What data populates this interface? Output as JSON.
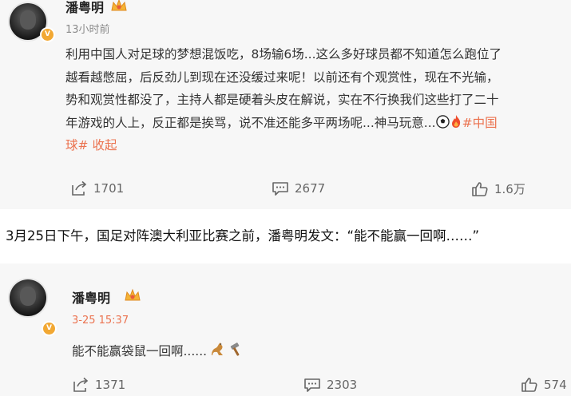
{
  "post1": {
    "username": "潘粤明",
    "time": "13小时前",
    "lines": [
      "利用中国人对足球的梦想混饭吃，8场输6场...这么多好球员都不知道怎么跑位了",
      "越看越憋屈，后反劲儿到现在还没缓过来呢！以前还有个观赏性，现在不光输，",
      "势和观赏性都没了，主持人都是硬着头皮在解说，实在不行换我们这些打了二十",
      "年游戏的人上，反正都是挨骂，说不准还能多平两场呢...神马玩意..."
    ],
    "topic_start": "#中国",
    "topic_end": "球#",
    "fold_label": "收起",
    "reposts": "1701",
    "comments": "2677",
    "likes": "1.6万"
  },
  "caption": "3月25日下午，国足对阵澳大利亚比赛之前，潘粤明发文：“能不能赢一回啊……”",
  "post2": {
    "username": "潘粤明",
    "time": "3-25 15:37",
    "text": "能不能赢袋鼠一回啊......",
    "reposts": "1371",
    "comments": "2303",
    "likes": "574"
  },
  "icons": [
    "verified-badge-icon",
    "crown-badge-icon",
    "soccer-ball-icon",
    "fire-icon",
    "kangaroo-icon",
    "hammer-icon",
    "repost-icon",
    "comment-icon",
    "like-icon"
  ],
  "colors": {
    "link": "#eb7350",
    "badge": "#f2a833",
    "card_bg": "#f7f7f7"
  }
}
